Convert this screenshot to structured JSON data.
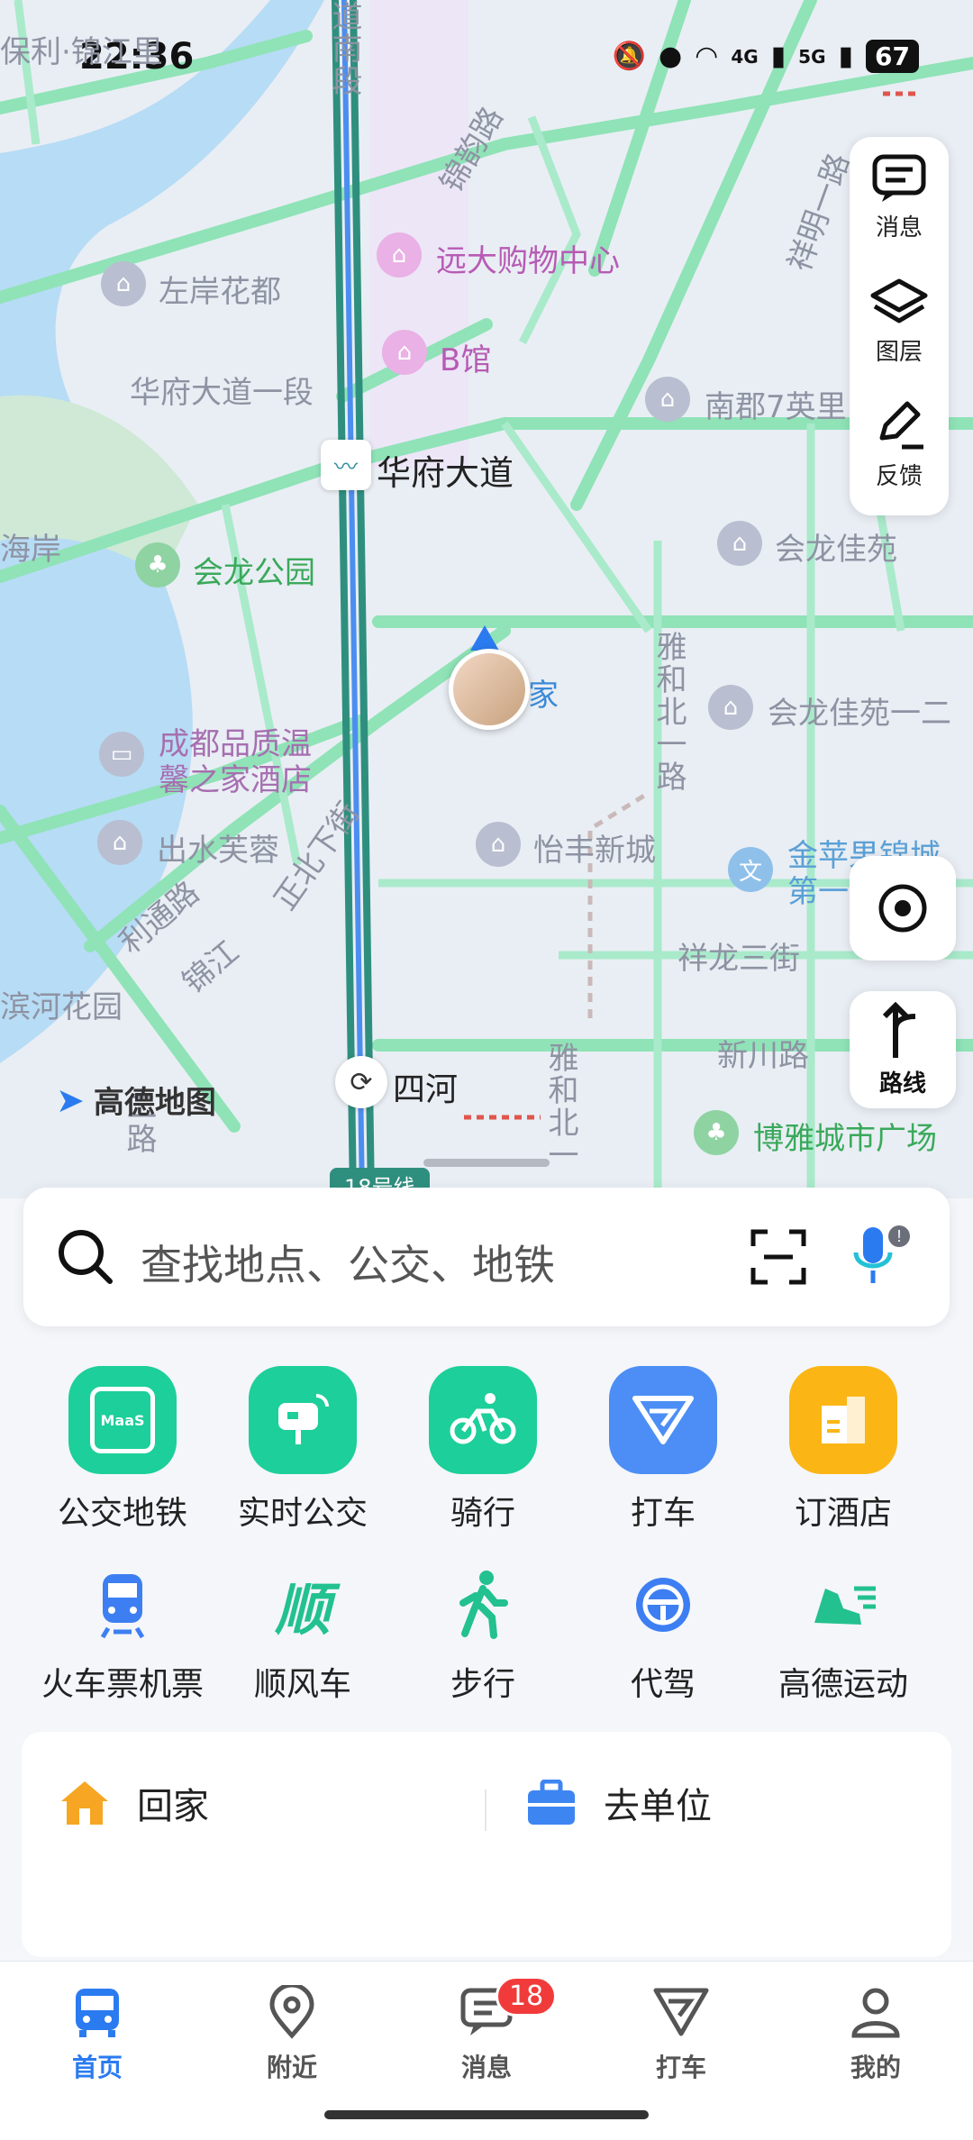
{
  "status": {
    "time": "22:36",
    "network1": "4G",
    "network2": "5G",
    "battery": "67"
  },
  "map": {
    "labels": {
      "baoli": "保利·锦江里",
      "road_tianfu_south": "道南段",
      "jinli_road": "锦韵路",
      "yuanda": "远大购物中心",
      "zuoan": "左岸花都",
      "bguan": "B馆",
      "huafu_yiduan": "华府大道一段",
      "nanjun": "南郡7英里",
      "xiangming": "祥明一路",
      "huafu_station": "华府大道",
      "haian": "海岸",
      "huilong_park": "会龙公园",
      "huilong_jiayuan": "会龙佳苑",
      "home": "家",
      "yahebei": "雅和北一路",
      "huilong_jiayuan2": "会龙佳苑一二",
      "chengdu_hotel_1": "成都品质温",
      "chengdu_hotel_2": "馨之家酒店",
      "chushui": "出水芙蓉",
      "yifeng": "怡丰新城",
      "zhengbei": "正北下街",
      "litong": "利通路",
      "jinjiang": "锦江",
      "jinping_1": "金苹果锦城",
      "jinping_2": "第一",
      "xianglong": "祥龙三街",
      "binhe": "滨河花园",
      "xinchuan": "新川路",
      "sihe": "四河",
      "yahebei2": "雅和北一",
      "boya": "博雅城市广场",
      "line18": "18号线",
      "road_small": "二路"
    },
    "brand": "高德地图"
  },
  "sidepanel": {
    "messages": "消息",
    "layers": "图层",
    "feedback": "反馈"
  },
  "route_button": "路线",
  "search": {
    "placeholder": "查找地点、公交、地铁"
  },
  "services": [
    {
      "label": "公交地铁",
      "icon": "bus-metro-icon",
      "color": "#1dcf9a",
      "maas": "MaaS"
    },
    {
      "label": "实时公交",
      "icon": "realtime-bus-icon",
      "color": "#1dcf9a"
    },
    {
      "label": "骑行",
      "icon": "bike-icon",
      "color": "#1dcf9a"
    },
    {
      "label": "打车",
      "icon": "taxi-icon",
      "color": "#4c8ef5"
    },
    {
      "label": "订酒店",
      "icon": "hotel-icon",
      "color": "#fbb616"
    },
    {
      "label": "火车票机票",
      "icon": "train-icon",
      "color": "#3d7ff2"
    },
    {
      "label": "顺风车",
      "icon": "carpool-icon",
      "color": "#22c18d",
      "glyph": "顺"
    },
    {
      "label": "步行",
      "icon": "walk-icon",
      "color": "#22c18d"
    },
    {
      "label": "代驾",
      "icon": "steering-icon",
      "color": "#3d7ff2"
    },
    {
      "label": "高德运动",
      "icon": "sport-shoe-icon",
      "color": "#22c18d"
    }
  ],
  "shortcuts": {
    "home": "回家",
    "work": "去单位"
  },
  "tabs": [
    {
      "label": "首页",
      "icon": "home-bus-icon"
    },
    {
      "label": "附近",
      "icon": "location-pin-icon"
    },
    {
      "label": "消息",
      "icon": "message-icon",
      "badge": "18"
    },
    {
      "label": "打车",
      "icon": "taxi-tab-icon"
    },
    {
      "label": "我的",
      "icon": "profile-icon"
    }
  ]
}
